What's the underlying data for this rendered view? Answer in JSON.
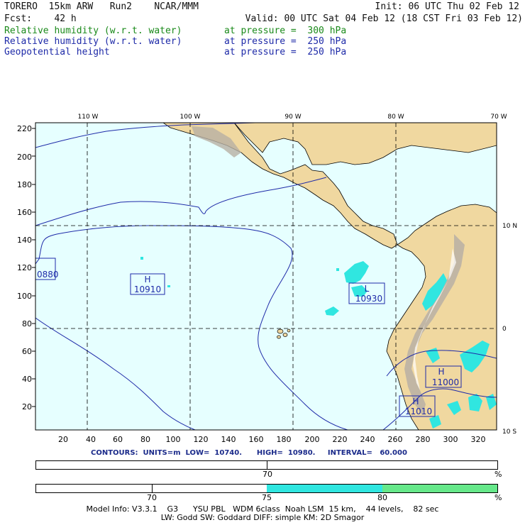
{
  "header": {
    "model": "TORERO  15km ARW   Run2    NCAR/MMM",
    "init": "Init: 06 UTC Thu 02 Feb 12",
    "fcst": "Fcst:    42 h",
    "valid": "Valid: 00 UTC Sat 04 Feb 12 (18 CST Fri 03 Feb 12)",
    "fields": [
      {
        "name": "Relative humidity (w.r.t. water)",
        "level": "at pressure =  300 hPa",
        "color": "#1a8a1a"
      },
      {
        "name": "Relative humidity (w.r.t. water)",
        "level": "at pressure =  250 hPa",
        "color": "#1e2aa8"
      },
      {
        "name": "Geopotential height",
        "level": "at pressure =  250 hPa",
        "color": "#1e2aa8"
      }
    ]
  },
  "map": {
    "lon_labels": [
      "110 W",
      "100 W",
      "90 W",
      "80 W",
      "70 W"
    ],
    "lat_labels": [
      "10 N",
      "0",
      "10 S"
    ],
    "y_ticks": [
      "220",
      "200",
      "180",
      "160",
      "140",
      "120",
      "100",
      "80",
      "60",
      "40",
      "20"
    ],
    "x_ticks": [
      "20",
      "40",
      "60",
      "80",
      "100",
      "120",
      "140",
      "160",
      "180",
      "200",
      "220",
      "240",
      "260",
      "280",
      "300",
      "320"
    ],
    "ocean_color": "#e6ffff",
    "land_color": "#f0d8a0",
    "moist_color": "#30e6e0",
    "contour_color": "#1e2aa8",
    "pressure_centers": [
      {
        "type": "H",
        "value": "10910"
      },
      {
        "type": "L",
        "value": "10930"
      },
      {
        "type": "H",
        "value": "11000"
      },
      {
        "type": "H",
        "value": "11010"
      },
      {
        "type": "",
        "value": "0880"
      }
    ]
  },
  "contour_info": "CONTOURS:  UNITS=m  LOW=  10740.      HIGH=  10980.     INTERVAL=   60.000",
  "legend1": {
    "label": "70",
    "unit": "%"
  },
  "legend2": {
    "labels": [
      "70",
      "75",
      "80"
    ],
    "unit": "%",
    "colors": [
      "#30e6e0",
      "#66e88a"
    ]
  },
  "footer": {
    "line1": "Model Info: V3.3.1    G3      YSU PBL   WDM 6class  Noah LSM  15 km,    44 levels,    82 sec",
    "line2": "LW: Godd SW: Goddard DIFF: simple KM: 2D Smagor"
  }
}
